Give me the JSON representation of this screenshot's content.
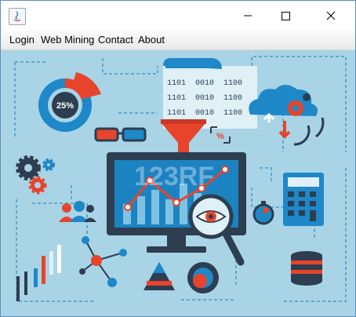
{
  "window": {
    "controls": {
      "minimize_icon": "minimize-icon",
      "maximize_icon": "maximize-icon",
      "close_icon": "close-icon"
    }
  },
  "menu": {
    "items": [
      "Login",
      "Web Mining",
      "Contact",
      "About"
    ]
  },
  "illustration": {
    "pie_percent_label": "25%",
    "binary_rows": [
      "1101  0010  1100",
      "1101  0010  1100",
      "1101  0010  1100"
    ],
    "percent_sign": "%",
    "watermark": "123RF"
  },
  "colors": {
    "background": "#a9d4e6",
    "dark": "#2c3e50",
    "blue": "#1e88c8",
    "red": "#e8442c",
    "light": "#dff0f7"
  }
}
